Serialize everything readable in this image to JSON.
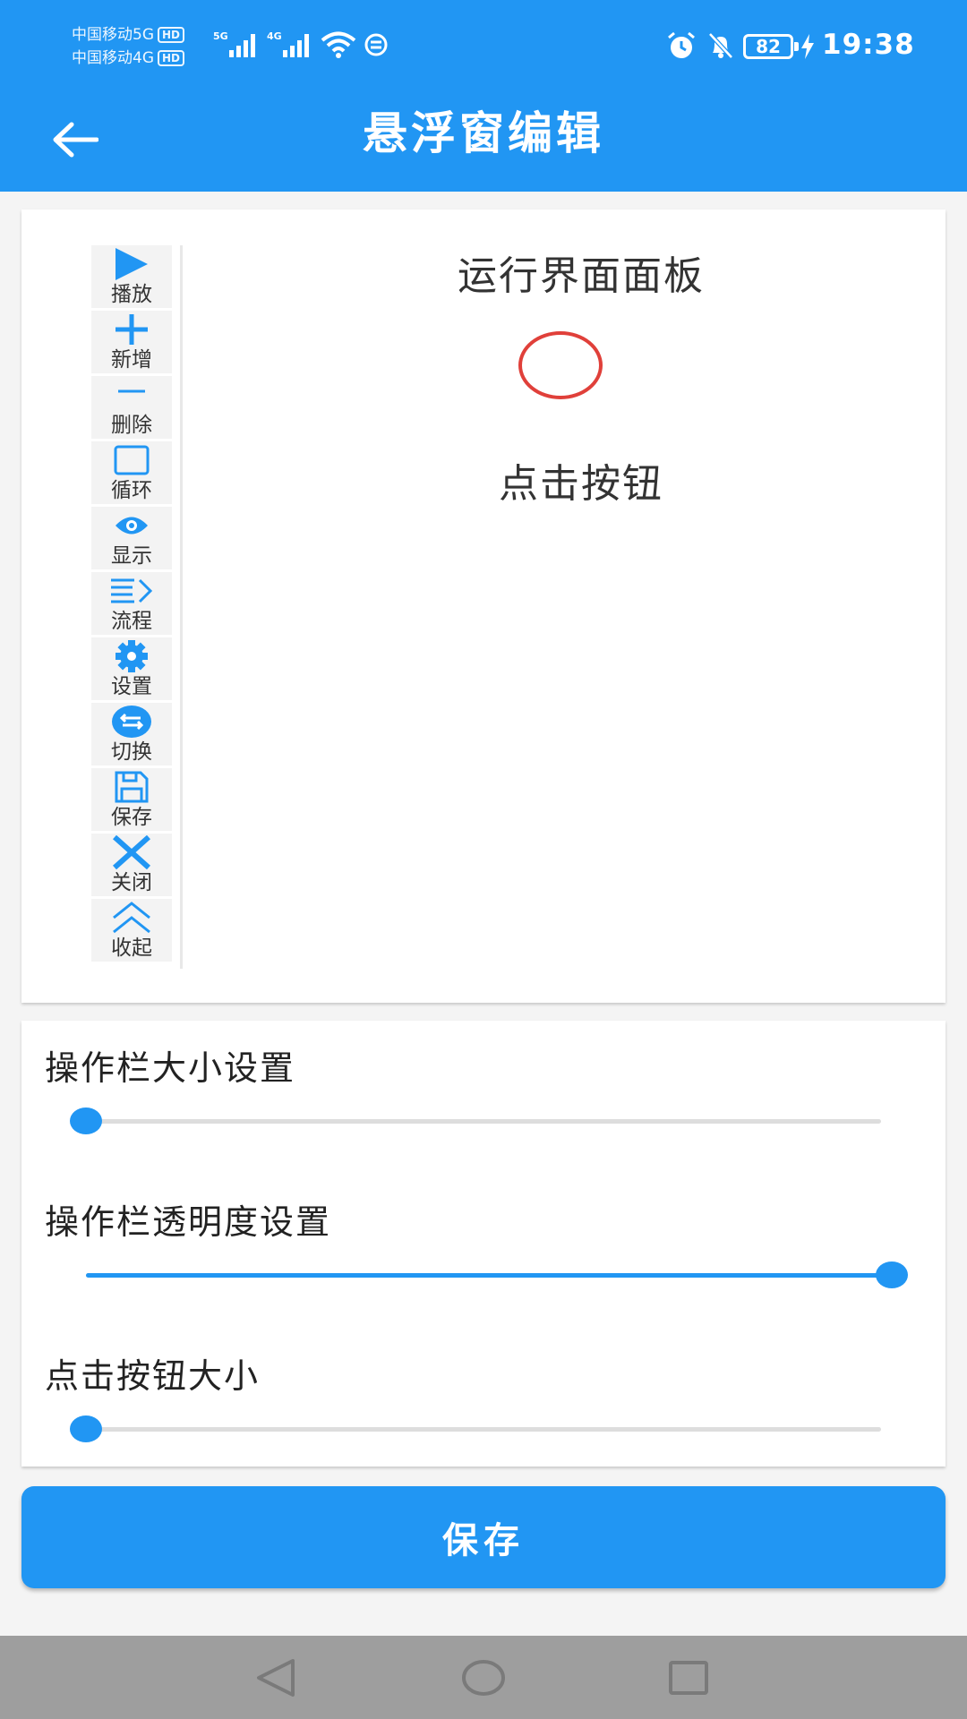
{
  "status_bar": {
    "carrier_1": "中国移动5G",
    "carrier_2": "中国移动4G",
    "hd_badge": "HD",
    "net_1": "5G",
    "net_2": "4G",
    "battery_level": "82",
    "time": "19:38"
  },
  "app_bar": {
    "title": "悬浮窗编辑",
    "back_icon": "arrow-left-icon"
  },
  "toolbar": {
    "items": [
      {
        "label": "播放",
        "icon": "play-icon"
      },
      {
        "label": "新增",
        "icon": "plus-icon"
      },
      {
        "label": "删除",
        "icon": "minus-icon"
      },
      {
        "label": "循环",
        "icon": "square-icon"
      },
      {
        "label": "显示",
        "icon": "eye-icon"
      },
      {
        "label": "流程",
        "icon": "list-arrow-icon"
      },
      {
        "label": "设置",
        "icon": "gear-icon"
      },
      {
        "label": "切换",
        "icon": "swap-icon"
      },
      {
        "label": "保存",
        "icon": "floppy-icon"
      },
      {
        "label": "关闭",
        "icon": "close-icon"
      },
      {
        "label": "收起",
        "icon": "chevron-double-up-icon"
      }
    ]
  },
  "preview": {
    "panel_title": "运行界面面板",
    "click_label": "点击按钮"
  },
  "settings": {
    "toolbar_size": {
      "label": "操作栏大小设置",
      "value": 0
    },
    "toolbar_opacity": {
      "label": "操作栏透明度设置",
      "value": 1
    },
    "click_button_size": {
      "label": "点击按钮大小",
      "value": 0
    }
  },
  "save_button": {
    "label": "保存"
  },
  "colors": {
    "primary": "#2196f3",
    "target_circle": "#e0403a",
    "nav_bar": "#9e9e9e"
  }
}
